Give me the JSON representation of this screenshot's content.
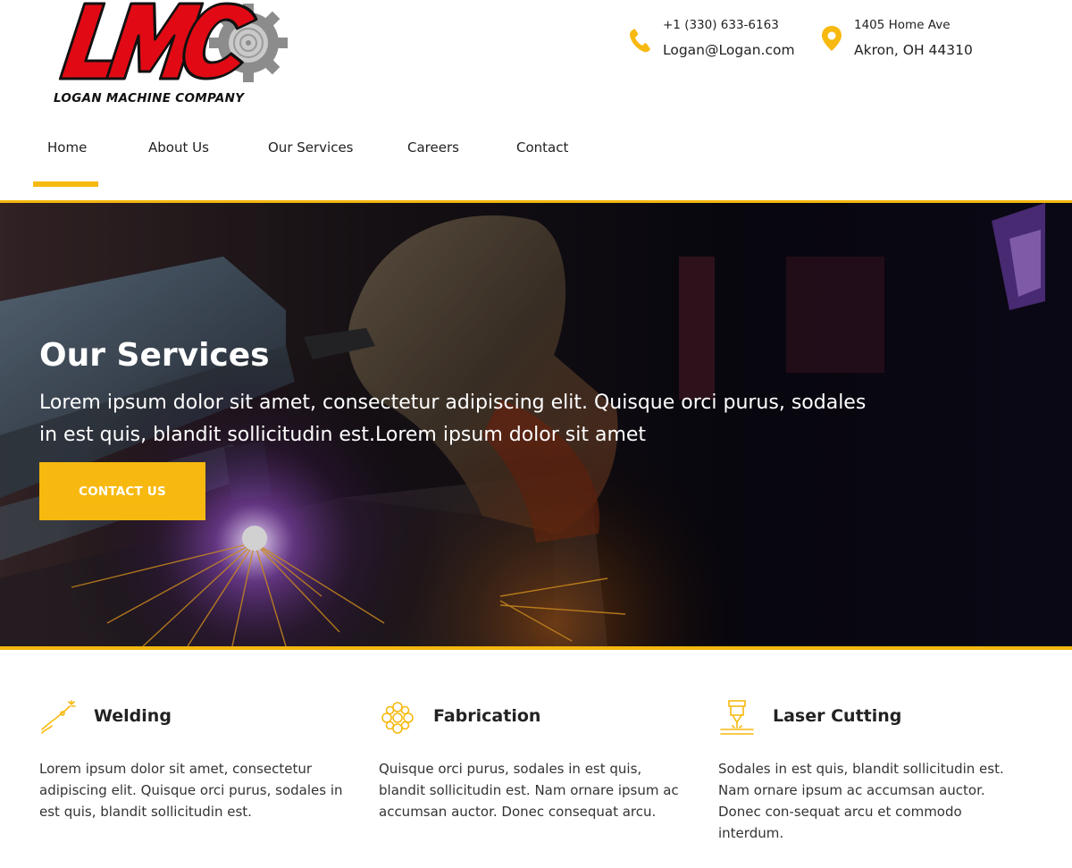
{
  "brand": {
    "logo_letters": "LMC",
    "company_name": "LOGAN MACHINE COMPANY",
    "primary_red": "#e10a14",
    "accent_yellow": "#f7b90f"
  },
  "contact": {
    "phone": "+1 (330) 633-6163",
    "email": "Logan@Logan.com",
    "address_line1": "1405 Home Ave",
    "address_line2": "Akron, OH 44310",
    "phone_icon": "phone-icon",
    "location_icon": "map-pin-icon"
  },
  "nav": {
    "items": [
      {
        "label": "Home",
        "active": true
      },
      {
        "label": "About Us",
        "active": false
      },
      {
        "label": "Our Services",
        "active": false
      },
      {
        "label": "Careers",
        "active": false
      },
      {
        "label": "Contact",
        "active": false
      }
    ]
  },
  "hero": {
    "title": "Our Services",
    "text": "Lorem ipsum dolor sit amet, consectetur adipiscing elit. Quisque orci purus, sodales in est quis, blandit sollicitudin est.Lorem ipsum dolor sit amet",
    "button_label": "CONTACT US"
  },
  "services": [
    {
      "icon": "welding-torch-icon",
      "title": "Welding",
      "description": "Lorem ipsum dolor sit amet, consectetur adipiscing elit. Quisque orci purus, sodales in est quis, blandit sollicitudin est."
    },
    {
      "icon": "fabrication-gear-icon",
      "title": "Fabrication",
      "description": "Quisque orci purus, sodales in est quis, blandit sollicitudin est. Nam ornare ipsum ac accumsan auctor. Donec consequat arcu."
    },
    {
      "icon": "laser-cutting-icon",
      "title": "Laser Cutting",
      "description": "Sodales in est quis, blandit sollicitudin est. Nam ornare ipsum ac accumsan auctor. Donec con-sequat arcu et commodo interdum."
    }
  ]
}
